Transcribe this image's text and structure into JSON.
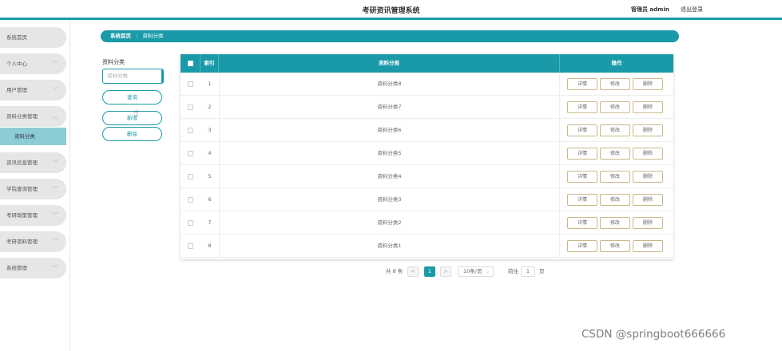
{
  "header": {
    "title": "考研资讯管理系统",
    "admin_label": "管理员 admin",
    "logout_label": "退出登录"
  },
  "sidebar": {
    "items": [
      {
        "label": "系统首页",
        "has_chevron": false
      },
      {
        "label": "个人中心",
        "has_chevron": true
      },
      {
        "label": "用户管理",
        "has_chevron": true
      },
      {
        "label": "资料分类管理",
        "has_chevron": true,
        "expanded": true
      },
      {
        "label": "资讯信息管理",
        "has_chevron": true
      },
      {
        "label": "学院查询管理",
        "has_chevron": true
      },
      {
        "label": "考研政策管理",
        "has_chevron": true
      },
      {
        "label": "考研资料管理",
        "has_chevron": true
      },
      {
        "label": "系统管理",
        "has_chevron": true
      }
    ],
    "active_sub": "资料分类"
  },
  "breadcrumb": {
    "home": "系统首页",
    "separator": "⋮",
    "current": "资料分类"
  },
  "filter": {
    "label": "资料分类",
    "placeholder": "资料分类",
    "query_button": "查询",
    "add_button": "新增",
    "delete_button": "删除"
  },
  "table": {
    "columns": [
      "索引",
      "资料分类",
      "操作"
    ],
    "rows": [
      {
        "index": "1",
        "name": "资料分类8"
      },
      {
        "index": "2",
        "name": "资料分类7"
      },
      {
        "index": "3",
        "name": "资料分类6"
      },
      {
        "index": "4",
        "name": "资料分类5"
      },
      {
        "index": "5",
        "name": "资料分类4"
      },
      {
        "index": "6",
        "name": "资料分类3"
      },
      {
        "index": "7",
        "name": "资料分类2"
      },
      {
        "index": "8",
        "name": "资料分类1"
      }
    ],
    "actions": [
      "详情",
      "修改",
      "删除"
    ]
  },
  "pagination": {
    "total": "共 8 条",
    "prev": "<",
    "page": "1",
    "next": ">",
    "page_size": "10条/页",
    "goto_label": "前往",
    "goto_value": "1",
    "page_unit": "页"
  },
  "watermark": "CSDN @springboot666666",
  "colors": {
    "accent": "#1a9aa8",
    "sub_active": "#8cccd3"
  }
}
